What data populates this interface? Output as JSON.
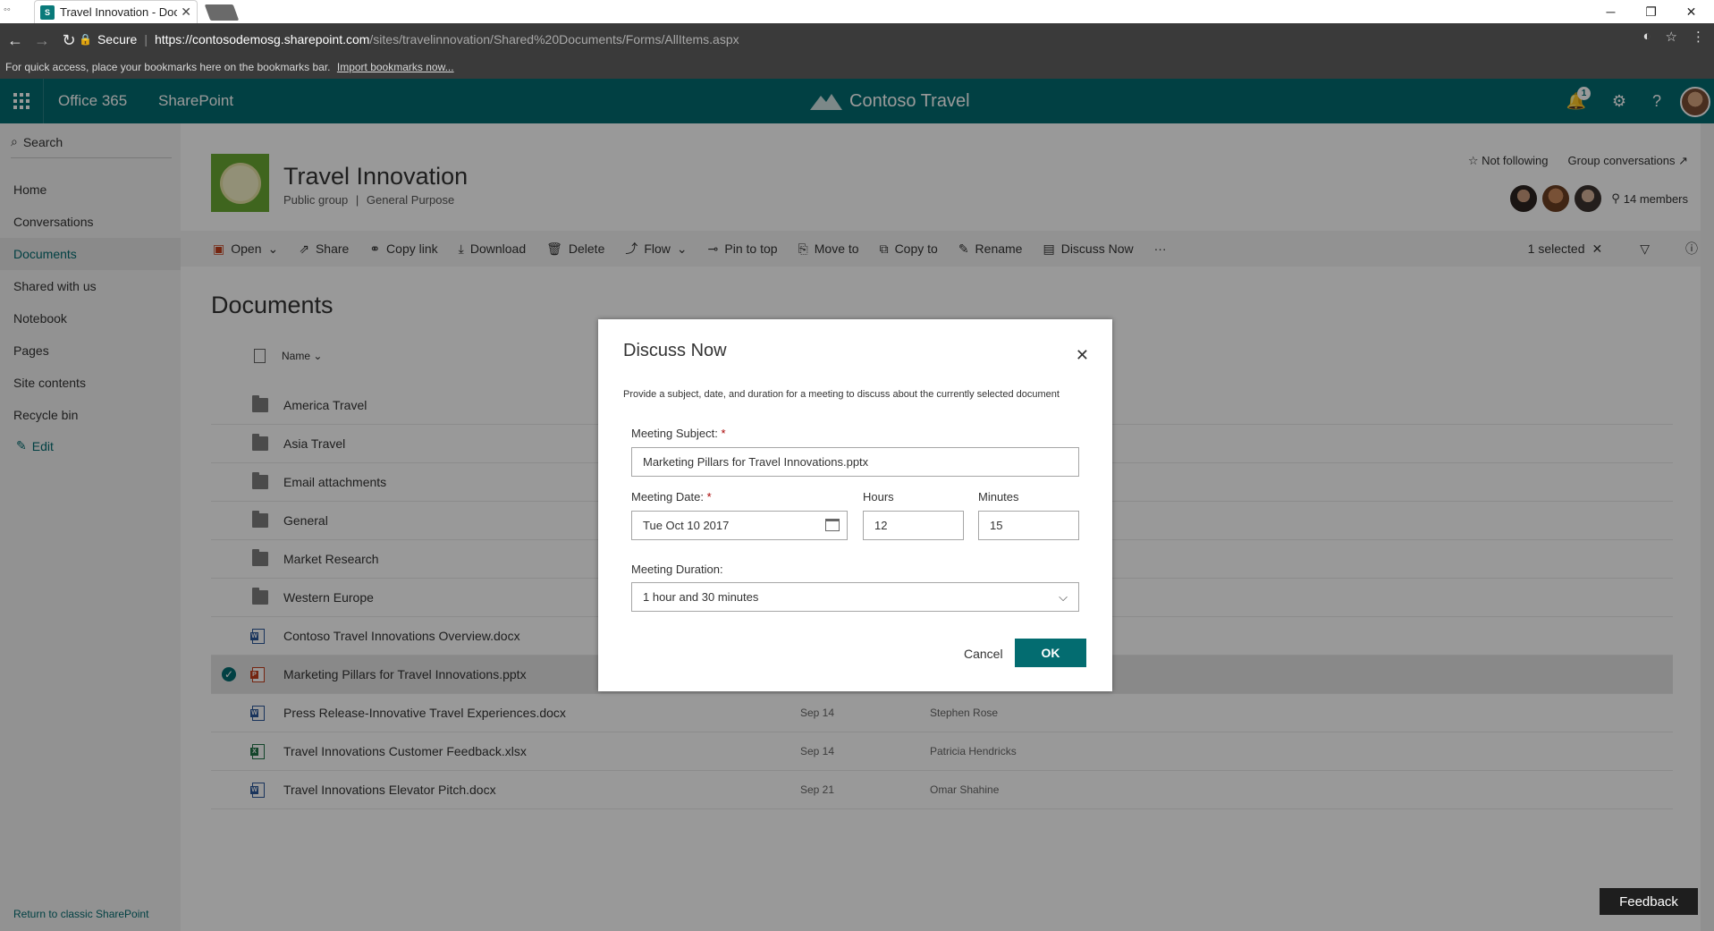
{
  "browser": {
    "tab_title": "Travel Innovation - Docu",
    "tab_favicon_text": "S",
    "secure_label": "Secure",
    "url_host": "https://contosodemosg.sharepoint.com",
    "url_path": "/sites/travelinnovation/Shared%20Documents/Forms/AllItems.aspx",
    "bookmarks_text": "For quick access, place your bookmarks here on the bookmarks bar.",
    "bookmarks_link": "Import bookmarks now..."
  },
  "suitebar": {
    "office": "Office 365",
    "app": "SharePoint",
    "brand": "Contoso Travel",
    "notification_count": "1",
    "bg_color": "#036c70"
  },
  "leftnav": {
    "search_label": "Search",
    "items": [
      {
        "label": "Home"
      },
      {
        "label": "Conversations"
      },
      {
        "label": "Documents"
      },
      {
        "label": "Shared with us"
      },
      {
        "label": "Notebook"
      },
      {
        "label": "Pages"
      },
      {
        "label": "Site contents"
      },
      {
        "label": "Recycle bin"
      }
    ],
    "active_item": "Documents",
    "edit_label": "Edit",
    "return_classic": "Return to classic SharePoint"
  },
  "site": {
    "title": "Travel Innovation",
    "subtitle_type": "Public group",
    "subtitle_sep": "|",
    "subtitle_class": "General Purpose",
    "follow": "Not following",
    "group_conv": "Group conversations",
    "members": "14 members"
  },
  "commands": {
    "open": "Open",
    "share": "Share",
    "copy_link": "Copy link",
    "download": "Download",
    "delete": "Delete",
    "flow": "Flow",
    "pin": "Pin to top",
    "move": "Move to",
    "copy": "Copy to",
    "rename": "Rename",
    "discuss": "Discuss Now",
    "more": "···",
    "selected": "1 selected"
  },
  "documents": {
    "heading": "Documents",
    "name_header": "Name",
    "rows": [
      {
        "name": "America Travel",
        "type": "folder",
        "date": "",
        "by": ""
      },
      {
        "name": "Asia Travel",
        "type": "folder",
        "date": "",
        "by": ""
      },
      {
        "name": "Email attachments",
        "type": "folder",
        "date": "",
        "by": ""
      },
      {
        "name": "General",
        "type": "folder",
        "date": "",
        "by": ""
      },
      {
        "name": "Market Research",
        "type": "folder",
        "date": "",
        "by": ""
      },
      {
        "name": "Western Europe",
        "type": "folder",
        "date": "",
        "by": ""
      },
      {
        "name": "Contoso Travel Innovations Overview.docx",
        "type": "docx",
        "date": "",
        "by": ""
      },
      {
        "name": "Marketing Pillars for Travel Innovations.pptx",
        "type": "pptx",
        "date": "",
        "by": ""
      },
      {
        "name": "Press Release-Innovative Travel Experiences.docx",
        "type": "docx",
        "date": "Sep 14",
        "by": "Stephen Rose"
      },
      {
        "name": "Travel Innovations Customer Feedback.xlsx",
        "type": "xlsx",
        "date": "Sep 14",
        "by": "Patricia Hendricks"
      },
      {
        "name": "Travel Innovations Elevator Pitch.docx",
        "type": "docx",
        "date": "Sep 21",
        "by": "Omar Shahine"
      }
    ]
  },
  "dialog": {
    "title": "Discuss Now",
    "description": "Provide a subject, date, and duration for a meeting to discuss about the currently selected document",
    "subject_label": "Meeting Subject:",
    "subject_value": "Marketing Pillars for Travel Innovations.pptx",
    "date_label": "Meeting Date:",
    "date_value": "Tue Oct 10 2017",
    "hours_label": "Hours",
    "hours_value": "12",
    "minutes_label": "Minutes",
    "minutes_value": "15",
    "duration_label": "Meeting Duration:",
    "duration_value": "1 hour and 30 minutes",
    "required_mark": "*",
    "cancel": "Cancel",
    "ok": "OK"
  },
  "feedback": "Feedback"
}
